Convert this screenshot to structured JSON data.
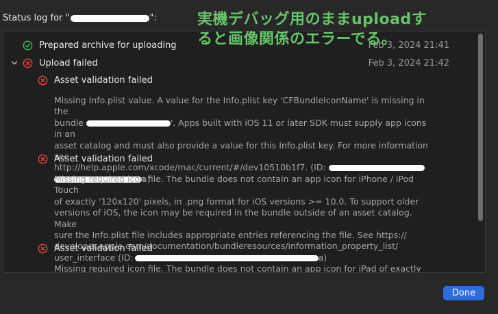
{
  "header": {
    "status_label_prefix": "Status log for \"",
    "status_label_suffix": "\":"
  },
  "log": {
    "items": [
      {
        "status": "success",
        "label": "Prepared archive for uploading",
        "timestamp": "Feb 3, 2024 21:41"
      },
      {
        "status": "error",
        "label": "Upload failed",
        "timestamp": "Feb 3, 2024 21:42"
      }
    ],
    "details": [
      {
        "title": "Asset validation failed",
        "message_lines": [
          "Missing Info.plist value. A value for the Info.plist key 'CFBundleIconName' is missing in the",
          "bundle",
          "'. Apps built with iOS 11 or later SDK must supply app icons in an",
          "asset catalog and must also provide a value for this Info.plist key. For more information see",
          "http://help.apple.com/xcode/mac/current/#/dev10510b1f7. (ID:",
          "a)"
        ]
      },
      {
        "title": "Asset validation failed",
        "message_lines": [
          "Missing required icon file. The bundle does not contain an app icon for iPhone / iPod Touch",
          "of exactly '120x120' pixels, in .png format for iOS versions >= 10.0. To support older",
          "versions of iOS, the icon may be required in the bundle outside of an asset catalog. Make",
          "sure the Info.plist file includes appropriate entries referencing the file. See https://",
          "developer.apple.com/documentation/bundleresources/information_property_list/",
          "user_interface (ID:",
          "a)"
        ]
      },
      {
        "title": "Asset validation failed",
        "message_lines": [
          "Missing required icon file. The bundle does not contain an app icon for iPad of exactly"
        ]
      }
    ]
  },
  "annotation": {
    "line1": "実機デバッグ用のままuploadす",
    "line2": "ると画像関係のエラーでる。"
  },
  "footer": {
    "done_label": "Done"
  },
  "colors": {
    "success": "#35c759",
    "error": "#ff453a",
    "accent": "#2b6de0",
    "annotation": "#67c46a"
  }
}
